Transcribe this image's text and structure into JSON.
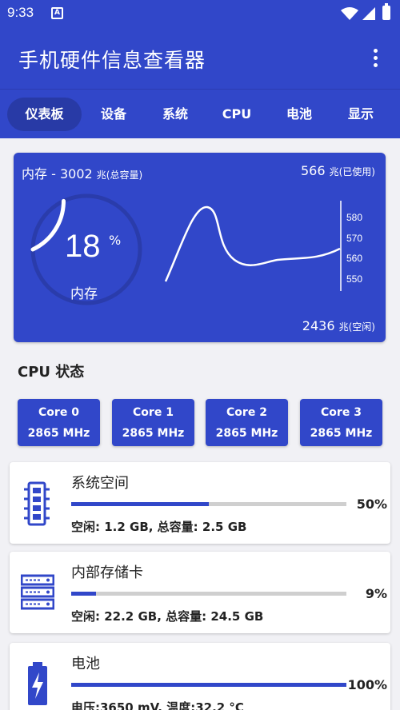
{
  "status_bar": {
    "time": "9:33",
    "app_icon_letter": "A"
  },
  "app_bar": {
    "title": "手机硬件信息查看器"
  },
  "tabs": [
    {
      "label": "仪表板",
      "active": true
    },
    {
      "label": "设备",
      "active": false
    },
    {
      "label": "系统",
      "active": false
    },
    {
      "label": "CPU",
      "active": false
    },
    {
      "label": "电池",
      "active": false
    },
    {
      "label": "显示",
      "active": false
    }
  ],
  "memory": {
    "title_prefix": "内存 - ",
    "total_value": "3002",
    "unit": "兆",
    "total_suffix": "(总容量)",
    "used_value": "566",
    "used_suffix": "(已使用)",
    "free_value": "2436",
    "free_suffix": "(空闲)",
    "percent": "18",
    "percent_sign": "%",
    "gauge_label": "内存",
    "usage_fraction": 0.18,
    "chart_ticks": [
      "580",
      "570",
      "560",
      "550"
    ]
  },
  "cpu_section": {
    "title": "CPU 状态",
    "cores": [
      {
        "name": "Core 0",
        "freq": "2865 MHz"
      },
      {
        "name": "Core 1",
        "freq": "2865 MHz"
      },
      {
        "name": "Core 2",
        "freq": "2865 MHz"
      },
      {
        "name": "Core 3",
        "freq": "2865 MHz"
      }
    ]
  },
  "storage": {
    "system": {
      "title": "系统空间",
      "percent": "50%",
      "fraction": 0.5,
      "detail": "空闲: 1.2 GB, 总容量: 2.5 GB",
      "icon": "memory-chip-icon"
    },
    "internal": {
      "title": "内部存储卡",
      "percent": "9%",
      "fraction": 0.09,
      "detail": "空闲: 22.2 GB, 总容量: 24.5 GB",
      "icon": "server-storage-icon"
    },
    "battery": {
      "title": "电池",
      "percent": "100%",
      "fraction": 1.0,
      "detail": "电压:3650 mV, 温度:32.2 °C",
      "icon": "battery-charging-icon"
    }
  },
  "colors": {
    "primary": "#3147c9",
    "primary_dark": "#283aa6",
    "background": "#f1f1f5",
    "track": "#cfcfcf"
  }
}
